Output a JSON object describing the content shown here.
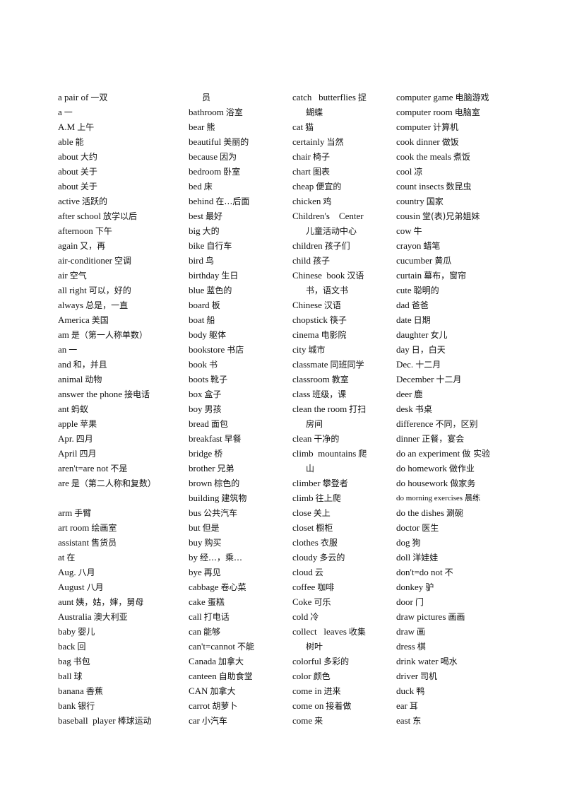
{
  "document": {
    "columns": [
      {
        "entries": [
          {
            "en": "a pair of",
            "zh": "一双"
          },
          {
            "en": "a",
            "zh": "一"
          },
          {
            "en": "A.M",
            "zh": "上午"
          },
          {
            "en": "able",
            "zh": "能"
          },
          {
            "en": "about",
            "zh": "大约"
          },
          {
            "en": "about",
            "zh": "关于"
          },
          {
            "en": "about",
            "zh": "关于"
          },
          {
            "en": "active",
            "zh": "活跃的"
          },
          {
            "en": "after school",
            "zh": "放学以后"
          },
          {
            "en": "afternoon",
            "zh": "下午"
          },
          {
            "en": "again",
            "zh": "又，再"
          },
          {
            "en": "air-conditioner",
            "zh": "空调"
          },
          {
            "en": "air",
            "zh": "空气"
          },
          {
            "en": "all right",
            "zh": "可以，好的"
          },
          {
            "en": "always",
            "zh": "总是，一直"
          },
          {
            "en": "America",
            "zh": "美国"
          },
          {
            "en": "am",
            "zh": "是（第一人称单数）"
          },
          {
            "en": "an",
            "zh": "一"
          },
          {
            "en": "and",
            "zh": "和，并且"
          },
          {
            "en": "animal",
            "zh": "动物"
          },
          {
            "en": "answer the phone",
            "zh": "接电话"
          },
          {
            "en": "ant",
            "zh": "蚂蚁"
          },
          {
            "en": "apple",
            "zh": "苹果"
          },
          {
            "en": "Apr.",
            "zh": "四月"
          },
          {
            "en": "April",
            "zh": "四月"
          },
          {
            "en": "aren't=are not",
            "zh": "不是"
          },
          {
            "en": "are",
            "zh": "是（第二人称和复数）"
          },
          {
            "en": "",
            "zh": ""
          },
          {
            "en": "arm",
            "zh": "手臂"
          },
          {
            "en": "art room",
            "zh": "绘画室"
          },
          {
            "en": "assistant",
            "zh": "售货员"
          },
          {
            "en": "at",
            "zh": "在"
          },
          {
            "en": "Aug.",
            "zh": "八月"
          },
          {
            "en": "August",
            "zh": "八月"
          },
          {
            "en": "aunt",
            "zh": "姨，姑，婶，舅母"
          },
          {
            "en": "Australia",
            "zh": "澳大利亚"
          },
          {
            "en": "baby",
            "zh": "婴儿"
          },
          {
            "en": "back",
            "zh": "回"
          },
          {
            "en": "bag",
            "zh": "书包"
          },
          {
            "en": "ball",
            "zh": "球"
          },
          {
            "en": "banana",
            "zh": "香蕉"
          },
          {
            "en": "bank",
            "zh": "银行"
          },
          {
            "en": "baseball  player",
            "zh": "棒球运动"
          }
        ]
      },
      {
        "entries": [
          {
            "en": "",
            "zh": "员",
            "indent": true
          },
          {
            "en": "bathroom",
            "zh": "浴室"
          },
          {
            "en": "bear",
            "zh": "熊"
          },
          {
            "en": "beautiful",
            "zh": "美丽的"
          },
          {
            "en": "because",
            "zh": "因为"
          },
          {
            "en": "bedroom",
            "zh": "卧室"
          },
          {
            "en": "bed",
            "zh": "床"
          },
          {
            "en": "behind",
            "zh": "在…后面"
          },
          {
            "en": "best",
            "zh": "最好"
          },
          {
            "en": "big",
            "zh": "大的"
          },
          {
            "en": "bike",
            "zh": "自行车"
          },
          {
            "en": "bird",
            "zh": "鸟"
          },
          {
            "en": "birthday",
            "zh": "生日"
          },
          {
            "en": "blue",
            "zh": "蓝色的"
          },
          {
            "en": "board",
            "zh": "板"
          },
          {
            "en": "boat",
            "zh": "船"
          },
          {
            "en": "body",
            "zh": "躯体"
          },
          {
            "en": "bookstore",
            "zh": "书店"
          },
          {
            "en": "book",
            "zh": "书"
          },
          {
            "en": "boots",
            "zh": "靴子"
          },
          {
            "en": "box",
            "zh": "盒子"
          },
          {
            "en": "boy",
            "zh": "男孩"
          },
          {
            "en": "bread",
            "zh": "面包"
          },
          {
            "en": "breakfast",
            "zh": "早餐"
          },
          {
            "en": "bridge",
            "zh": "桥"
          },
          {
            "en": "brother",
            "zh": "兄弟"
          },
          {
            "en": "brown",
            "zh": "棕色的"
          },
          {
            "en": "building",
            "zh": "建筑物"
          },
          {
            "en": "bus",
            "zh": "公共汽车"
          },
          {
            "en": "but",
            "zh": "但是"
          },
          {
            "en": "buy",
            "zh": "购买"
          },
          {
            "en": "by",
            "zh": "经…，乘…"
          },
          {
            "en": "bye",
            "zh": "再见"
          },
          {
            "en": "cabbage",
            "zh": "卷心菜"
          },
          {
            "en": "cake",
            "zh": "蛋糕"
          },
          {
            "en": "call",
            "zh": "打电话"
          },
          {
            "en": "can",
            "zh": "能够"
          },
          {
            "en": "can't=cannot",
            "zh": "不能"
          },
          {
            "en": "Canada",
            "zh": "加拿大"
          },
          {
            "en": "canteen",
            "zh": "自助食堂"
          },
          {
            "en": "CAN",
            "zh": "加拿大"
          },
          {
            "en": "carrot",
            "zh": "胡萝卜"
          },
          {
            "en": "car",
            "zh": "小汽车"
          }
        ]
      },
      {
        "entries": [
          {
            "en": "catch   butterflies",
            "zh": "捉"
          },
          {
            "en": "",
            "zh": "蝴蝶",
            "indent": true
          },
          {
            "en": "cat",
            "zh": "猫"
          },
          {
            "en": "certainly",
            "zh": "当然"
          },
          {
            "en": "chair",
            "zh": "椅子"
          },
          {
            "en": "chart",
            "zh": "图表"
          },
          {
            "en": "cheap",
            "zh": "便宜的"
          },
          {
            "en": "chicken",
            "zh": "鸡"
          },
          {
            "en": "Children's    Center",
            "zh": ""
          },
          {
            "en": "",
            "zh": "儿童活动中心",
            "indent": true
          },
          {
            "en": "children",
            "zh": "孩子们"
          },
          {
            "en": "child",
            "zh": "孩子"
          },
          {
            "en": "Chinese  book",
            "zh": "汉语"
          },
          {
            "en": "",
            "zh": "书，语文书",
            "indent": true
          },
          {
            "en": "Chinese",
            "zh": "汉语"
          },
          {
            "en": "chopstick",
            "zh": "筷子"
          },
          {
            "en": "cinema",
            "zh": "电影院"
          },
          {
            "en": "city",
            "zh": "城市"
          },
          {
            "en": "classmate",
            "zh": "同班同学"
          },
          {
            "en": "classroom",
            "zh": "教室"
          },
          {
            "en": "class",
            "zh": "班级，课"
          },
          {
            "en": "clean the room",
            "zh": "打扫"
          },
          {
            "en": "",
            "zh": "房间",
            "indent": true
          },
          {
            "en": "clean",
            "zh": "干净的"
          },
          {
            "en": "climb  mountains",
            "zh": "爬"
          },
          {
            "en": "",
            "zh": "山",
            "indent": true
          },
          {
            "en": "climber",
            "zh": "攀登者"
          },
          {
            "en": "climb",
            "zh": "往上爬"
          },
          {
            "en": "close",
            "zh": "关上"
          },
          {
            "en": "closet",
            "zh": "橱柜"
          },
          {
            "en": "clothes",
            "zh": "衣服"
          },
          {
            "en": "cloudy",
            "zh": "多云的"
          },
          {
            "en": "cloud",
            "zh": "云"
          },
          {
            "en": "coffee",
            "zh": "咖啡"
          },
          {
            "en": "Coke",
            "zh": "可乐"
          },
          {
            "en": "cold",
            "zh": "冷"
          },
          {
            "en": "collect   leaves",
            "zh": "收集"
          },
          {
            "en": "",
            "zh": "树叶",
            "indent": true
          },
          {
            "en": "colorful",
            "zh": "多彩的"
          },
          {
            "en": "color",
            "zh": "颜色"
          },
          {
            "en": "come in",
            "zh": "进来"
          },
          {
            "en": "come on",
            "zh": "接着做"
          },
          {
            "en": "come",
            "zh": "来"
          }
        ]
      },
      {
        "entries": [
          {
            "en": "computer game",
            "zh": "电脑游戏"
          },
          {
            "en": "computer room",
            "zh": "电脑室"
          },
          {
            "en": "computer",
            "zh": "计算机"
          },
          {
            "en": "cook dinner",
            "zh": "做饭"
          },
          {
            "en": "cook the meals",
            "zh": "煮饭"
          },
          {
            "en": "cool",
            "zh": "凉"
          },
          {
            "en": "count insects",
            "zh": "数昆虫"
          },
          {
            "en": "country",
            "zh": "国家"
          },
          {
            "en": "cousin",
            "zh": "堂(表)兄弟姐妹"
          },
          {
            "en": "cow",
            "zh": "牛"
          },
          {
            "en": "crayon",
            "zh": "蜡笔"
          },
          {
            "en": "cucumber",
            "zh": "黄瓜"
          },
          {
            "en": "curtain",
            "zh": "幕布，窗帘"
          },
          {
            "en": "cute",
            "zh": "聪明的"
          },
          {
            "en": "dad",
            "zh": "爸爸"
          },
          {
            "en": "date",
            "zh": "日期"
          },
          {
            "en": "daughter",
            "zh": "女儿"
          },
          {
            "en": "day",
            "zh": "日，白天"
          },
          {
            "en": "Dec.",
            "zh": "十二月"
          },
          {
            "en": "December",
            "zh": "十二月"
          },
          {
            "en": "deer",
            "zh": "鹿"
          },
          {
            "en": "desk",
            "zh": "书桌"
          },
          {
            "en": "difference",
            "zh": "不同，区别"
          },
          {
            "en": "dinner",
            "zh": "正餐，宴会"
          },
          {
            "en": "do an experiment",
            "zh": "做 实验"
          },
          {
            "en": "do homework",
            "zh": "做作业"
          },
          {
            "en": "do housework",
            "zh": "做家务"
          },
          {
            "en": "do morning exercises",
            "zh": "晨练",
            "small": true
          },
          {
            "en": "do the dishes",
            "zh": "涮碗"
          },
          {
            "en": "doctor",
            "zh": "医生"
          },
          {
            "en": "dog",
            "zh": "狗"
          },
          {
            "en": "doll",
            "zh": "洋娃娃"
          },
          {
            "en": "don't=do not",
            "zh": "不"
          },
          {
            "en": "donkey",
            "zh": "驴"
          },
          {
            "en": "door",
            "zh": "门"
          },
          {
            "en": "draw pictures",
            "zh": "画画"
          },
          {
            "en": "draw",
            "zh": "画"
          },
          {
            "en": "dress",
            "zh": "棋"
          },
          {
            "en": "drink water",
            "zh": "喝水"
          },
          {
            "en": "driver",
            "zh": "司机"
          },
          {
            "en": "duck",
            "zh": "鸭"
          },
          {
            "en": "ear",
            "zh": "耳"
          },
          {
            "en": "east",
            "zh": "东"
          }
        ]
      }
    ]
  }
}
